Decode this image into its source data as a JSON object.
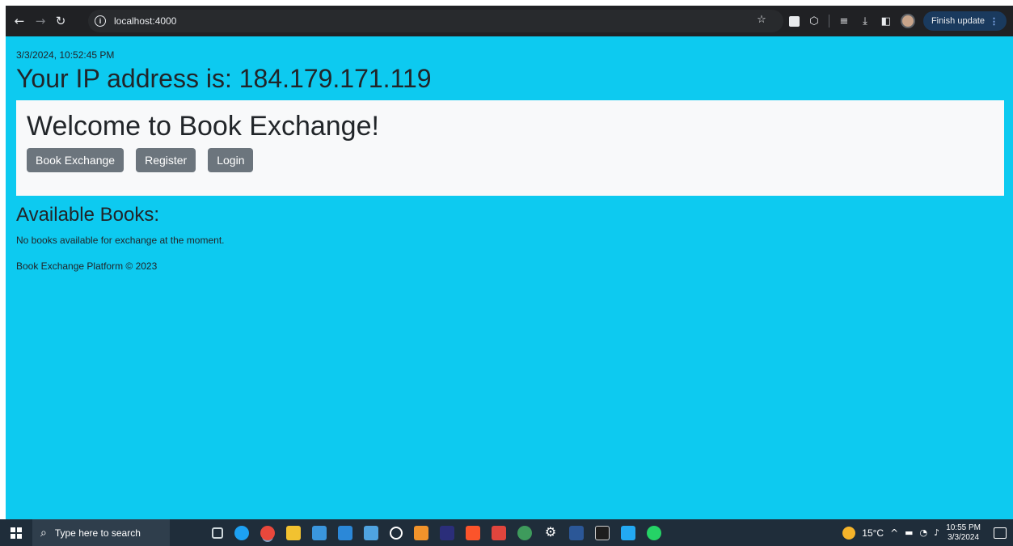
{
  "browser": {
    "url": "localhost:4000",
    "update_label": "Finish update"
  },
  "page": {
    "timestamp": "3/3/2024, 10:52:45 PM",
    "ip_text": "Your IP address is: 184.179.171.119",
    "welcome": "Welcome to Book Exchange!",
    "nav_buttons": [
      {
        "label": "Book Exchange"
      },
      {
        "label": "Register"
      },
      {
        "label": "Login"
      }
    ],
    "available_title": "Available Books:",
    "no_books_text": "No books available for exchange at the moment.",
    "footer": "Book Exchange Platform © 2023",
    "colors": {
      "background": "#0dcaf0",
      "jumbotron": "#f8f9fa",
      "button": "#6c757d"
    }
  },
  "taskbar": {
    "search_placeholder": "Type here to search",
    "weather": "15°C",
    "time": "10:55 PM",
    "date": "3/3/2024",
    "apps": [
      "task-view",
      "edge",
      "chrome",
      "file-explorer",
      "store",
      "mail",
      "media",
      "player",
      "sublime",
      "amazon-music",
      "brave",
      "app",
      "chrome-profile",
      "settings",
      "word",
      "terminal",
      "vscode",
      "whatsapp"
    ]
  }
}
